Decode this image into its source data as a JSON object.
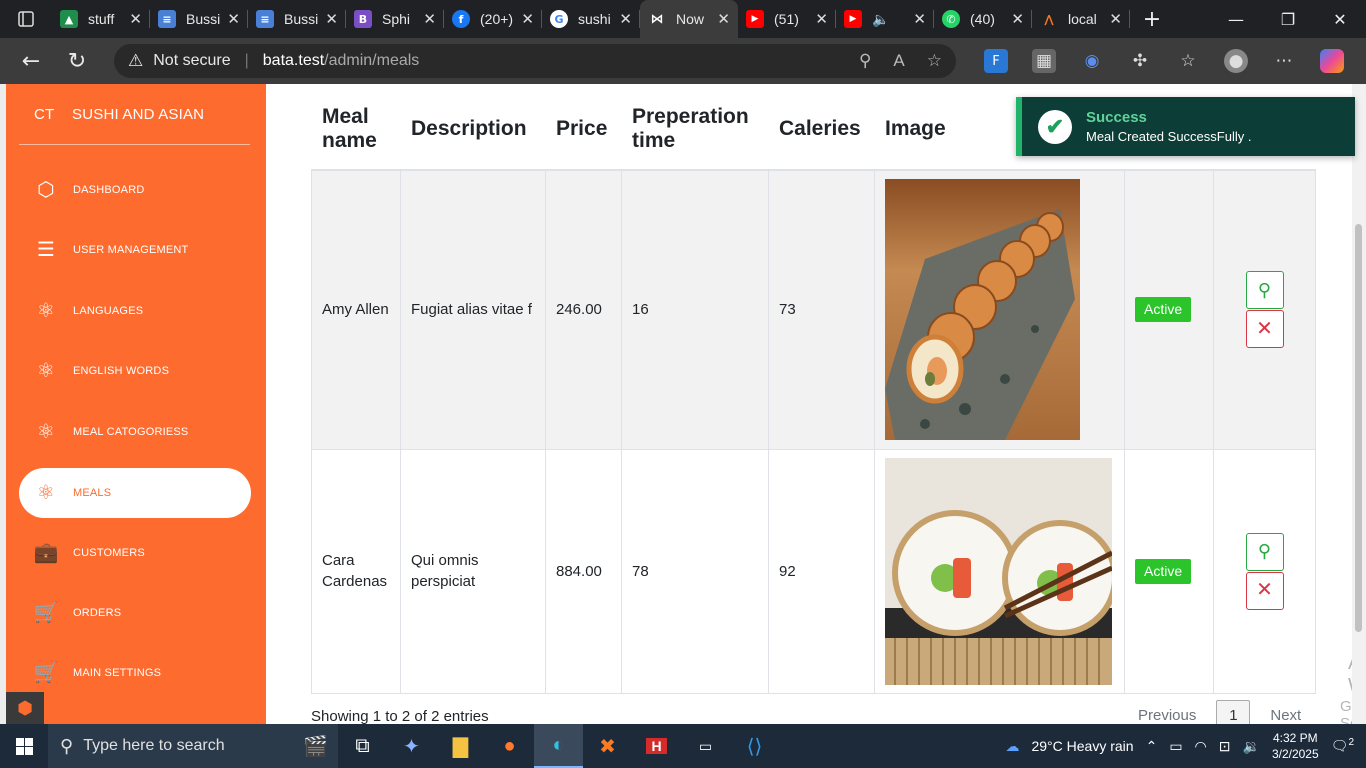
{
  "browser": {
    "tabs": [
      {
        "title": "stuff",
        "icon": "google-drive-icon",
        "color": "#2a7de1"
      },
      {
        "title": "Bussi",
        "icon": "docs-icon",
        "color": "#4a7fd6"
      },
      {
        "title": "Bussi",
        "icon": "docs-icon",
        "color": "#4a7fd6"
      },
      {
        "title": "Sphi",
        "icon": "bootstrap-icon",
        "color": "#7a4fc5"
      },
      {
        "title": "(20+)",
        "icon": "facebook-icon",
        "color": "#1877f2"
      },
      {
        "title": "sushi",
        "icon": "google-icon",
        "color": "#ffffff"
      },
      {
        "title": "Now",
        "icon": "bow-icon",
        "color": "#000000",
        "active": true
      },
      {
        "title": "(51)",
        "icon": "youtube-icon",
        "color": "#ff0000"
      },
      {
        "title": "",
        "icon": "youtube-icon",
        "color": "#ff0000"
      },
      {
        "title": "(40)",
        "icon": "whatsapp-icon",
        "color": "#25d366"
      },
      {
        "title": "local",
        "icon": "xampp-icon",
        "color": "#fb7a24"
      }
    ],
    "address": {
      "security": "Not secure",
      "host": "bata.test",
      "path": "/admin/meals"
    }
  },
  "sidebar": {
    "brand_abbr": "CT",
    "brand_name": "SUSHI AND ASIAN",
    "items": [
      {
        "label": "DASHBOARD",
        "icon": "cube-icon"
      },
      {
        "label": "USER MANAGEMENT",
        "icon": "list-icon"
      },
      {
        "label": "LANGUAGES",
        "icon": "atom-icon"
      },
      {
        "label": "ENGLISH WORDS",
        "icon": "atom-icon"
      },
      {
        "label": "MEAL CATOGORIESS",
        "icon": "atom-icon"
      },
      {
        "label": "MEALS",
        "icon": "atom-icon",
        "active": true
      },
      {
        "label": "CUSTOMERS",
        "icon": "briefcase-icon"
      },
      {
        "label": "ORDERS",
        "icon": "cart-icon"
      },
      {
        "label": "MAIN SETTINGS",
        "icon": "cart-icon"
      }
    ]
  },
  "table": {
    "headers": {
      "name": "Meal name",
      "description": "Description",
      "price": "Price",
      "prep": "Preperation time",
      "calories": "Caleries",
      "image": "Image"
    },
    "rows": [
      {
        "name": "Amy Allen",
        "description": "Fugiat alias vitae f",
        "price": "246.00",
        "prep": "16",
        "calories": "73",
        "status": "Active"
      },
      {
        "name": "Cara Cardenas",
        "description": "Qui omnis perspiciat",
        "price": "884.00",
        "prep": "78",
        "calories": "92",
        "status": "Active"
      }
    ],
    "footer": "Showing 1 to 2 of 2 entries",
    "pagination": {
      "previous": "Previous",
      "page": "1",
      "next": "Next"
    }
  },
  "toast": {
    "title": "Success",
    "message": "Meal Created SuccessFully ."
  },
  "watermark": {
    "title": "Activate Windows",
    "subtitle": "Go to Settings to activate Windows."
  },
  "taskbar": {
    "search_placeholder": "Type here to search",
    "weather": "29°C  Heavy rain",
    "time": "4:32 PM",
    "date": "3/2/2025",
    "notifications": "2"
  },
  "colors": {
    "accent": "#fd6b2f",
    "success": "#2bc52b",
    "danger": "#dc3545",
    "toast_bg": "#0c3d36"
  }
}
